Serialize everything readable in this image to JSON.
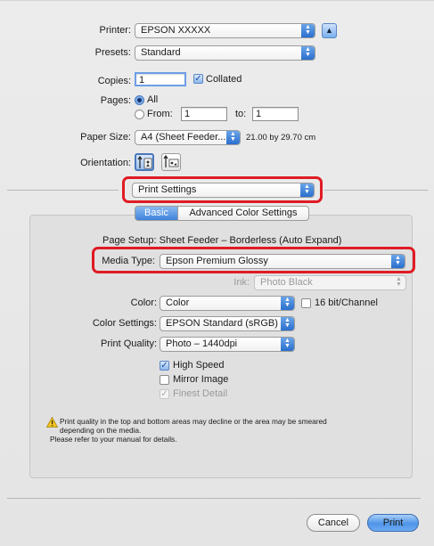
{
  "printer": {
    "label": "Printer:",
    "value": "EPSON XXXXX"
  },
  "presets": {
    "label": "Presets:",
    "value": "Standard"
  },
  "copies": {
    "label": "Copies:",
    "value": "1",
    "collated_label": "Collated"
  },
  "pages": {
    "label": "Pages:",
    "all_label": "All",
    "from_label": "From:",
    "from_value": "1",
    "to_label": "to:",
    "to_value": "1"
  },
  "paper_size": {
    "label": "Paper Size:",
    "value": "A4 (Sheet Feeder...",
    "dimensions": "21.00 by 29.70 cm"
  },
  "orientation": {
    "label": "Orientation:"
  },
  "section_popup": {
    "value": "Print Settings"
  },
  "tabs": [
    {
      "label": "Basic",
      "selected": true
    },
    {
      "label": "Advanced Color Settings",
      "selected": false
    }
  ],
  "page_setup": {
    "text": "Page Setup: Sheet Feeder – Borderless (Auto Expand)"
  },
  "media_type": {
    "label": "Media Type:",
    "value": "Epson Premium Glossy"
  },
  "ink": {
    "label": "Ink:",
    "value": "Photo Black"
  },
  "color": {
    "label": "Color:",
    "value": "Color",
    "bit_label": "16 bit/Channel"
  },
  "color_settings": {
    "label": "Color Settings:",
    "value": "EPSON Standard (sRGB)"
  },
  "print_quality": {
    "label": "Print Quality:",
    "value": "Photo – 1440dpi"
  },
  "options": {
    "high_speed": "High Speed",
    "mirror_image": "Mirror Image",
    "finest_detail": "Finest Detail"
  },
  "warning": {
    "line1": "Print quality in the top and bottom areas may decline or the area may be smeared",
    "line2": "depending on the media.",
    "line3": "Please refer to your manual for details."
  },
  "buttons": {
    "cancel": "Cancel",
    "print": "Print"
  },
  "colors": {
    "highlight": "#e01b24",
    "accent": "#2a6fce"
  }
}
